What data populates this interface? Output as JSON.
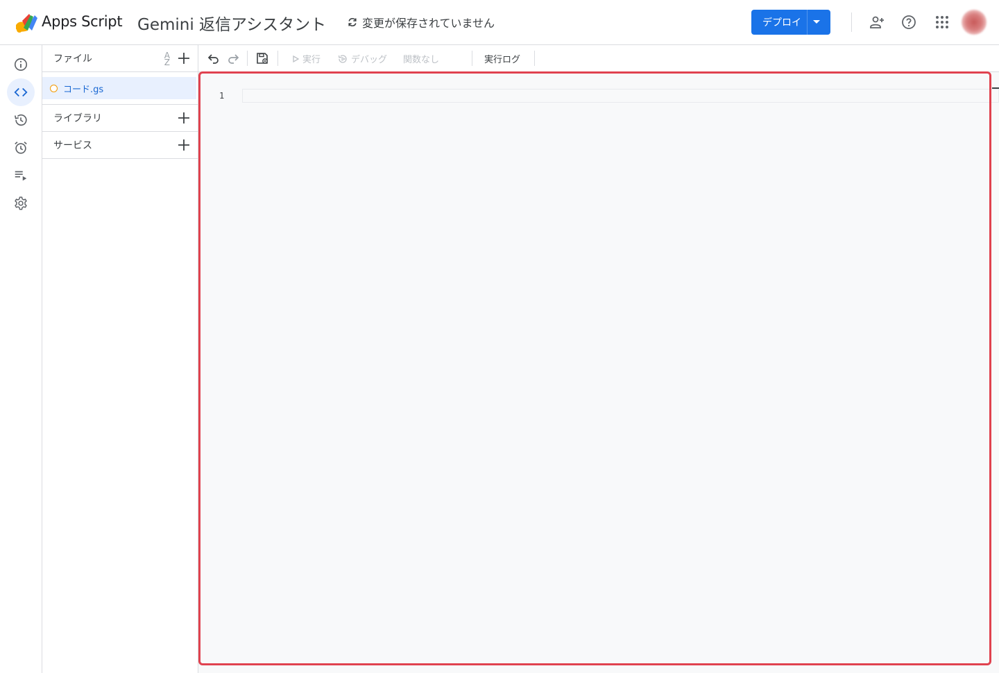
{
  "header": {
    "app_name": "Apps Script",
    "project_title": "Gemini 返信アシスタント",
    "save_status": "変更が保存されていません",
    "deploy_label": "デプロイ",
    "accent_color": "#1a73e8"
  },
  "rail": {
    "items": [
      {
        "icon": "info-icon"
      },
      {
        "icon": "code-icon",
        "active": true
      },
      {
        "icon": "history-icon"
      },
      {
        "icon": "alarm-icon"
      },
      {
        "icon": "executions-icon"
      },
      {
        "icon": "gear-icon"
      }
    ]
  },
  "files_panel": {
    "files_label": "ファイル",
    "sort_label_top": "A",
    "sort_label_bottom": "Z",
    "files": [
      {
        "name": "コード.gs",
        "selected": true
      }
    ],
    "libraries_label": "ライブラリ",
    "services_label": "サービス"
  },
  "toolbar": {
    "run_label": "実行",
    "debug_label": "デバッグ",
    "function_label": "関数なし",
    "log_label": "実行ログ"
  },
  "editor": {
    "line_numbers": [
      "1"
    ],
    "highlight_color": "#e0424f"
  }
}
